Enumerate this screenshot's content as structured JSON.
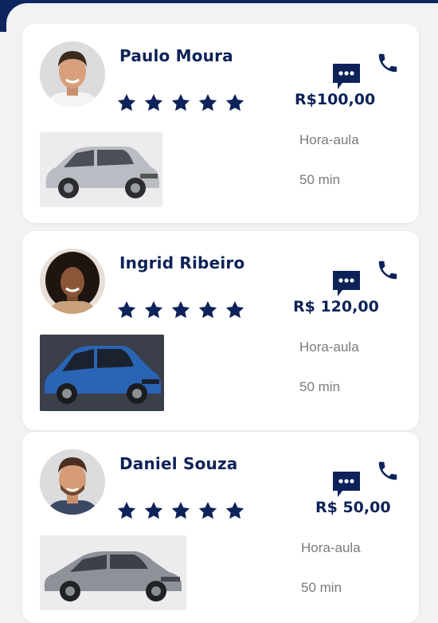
{
  "instructors": [
    {
      "name": "Paulo Moura",
      "rating": 5,
      "price": "R$100,00",
      "rate_label": "Hora-aula",
      "duration": "50 min",
      "avatar_icon": "man-portrait-icon",
      "car_icon": "silver-hatchback-icon",
      "car_color": "#b9bcc2"
    },
    {
      "name": "Ingrid Ribeiro",
      "rating": 5,
      "price": "R$ 120,00",
      "rate_label": "Hora-aula",
      "duration": "50 min",
      "avatar_icon": "woman-portrait-icon",
      "car_icon": "blue-hatchback-icon",
      "car_color": "#2a64b5"
    },
    {
      "name": "Daniel Souza",
      "rating": 5,
      "price": "R$ 50,00",
      "rate_label": "Hora-aula",
      "duration": "50 min",
      "avatar_icon": "man-portrait-icon",
      "car_icon": "gray-sedan-icon",
      "car_color": "#8e9198"
    }
  ],
  "colors": {
    "primary": "#0d2258",
    "frame": "#0f2560",
    "background": "#f2f2f4",
    "card": "#ffffff",
    "muted_text": "#7a7a80"
  }
}
